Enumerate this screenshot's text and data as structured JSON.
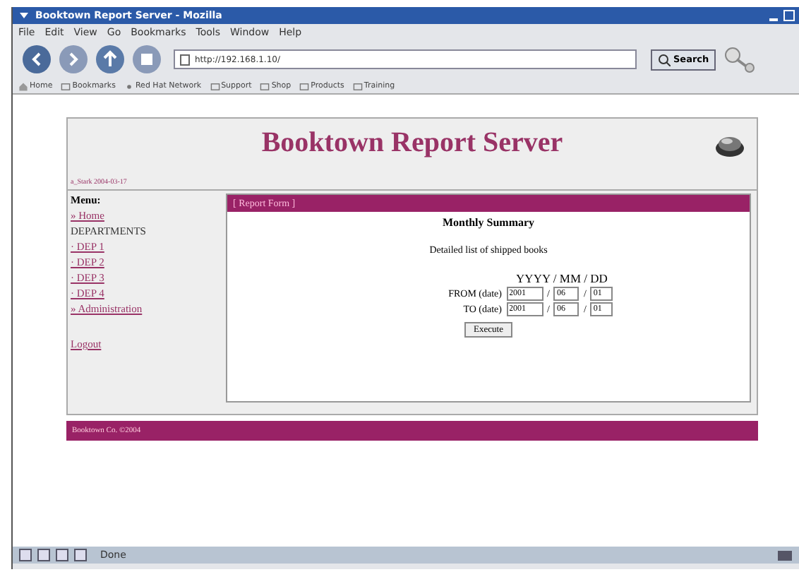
{
  "window": {
    "title": "Booktown Report Server - Mozilla"
  },
  "menu": [
    "File",
    "Edit",
    "View",
    "Go",
    "Bookmarks",
    "Tools",
    "Window",
    "Help"
  ],
  "address": {
    "value": "http://192.168.1.10/"
  },
  "search_button": "Search",
  "bookmarks": [
    {
      "label": "Home",
      "kind": "home"
    },
    {
      "label": "Bookmarks",
      "kind": "folder"
    },
    {
      "label": "Red Hat Network",
      "kind": "link"
    },
    {
      "label": "Support",
      "kind": "folder"
    },
    {
      "label": "Shop",
      "kind": "folder"
    },
    {
      "label": "Products",
      "kind": "folder"
    },
    {
      "label": "Training",
      "kind": "folder"
    }
  ],
  "page": {
    "title": "Booktown Report Server",
    "user_line": "a_Stark 2004-03-17",
    "sidebar": {
      "heading": "Menu:",
      "items": [
        {
          "label": "» Home",
          "kind": "link"
        },
        {
          "label": "DEPARTMENTS",
          "kind": "heading"
        },
        {
          "label": "· DEP 1",
          "kind": "link"
        },
        {
          "label": "· DEP 2",
          "kind": "link"
        },
        {
          "label": "· DEP 3",
          "kind": "link"
        },
        {
          "label": "· DEP 4",
          "kind": "link"
        },
        {
          "label": "» Administration",
          "kind": "link"
        },
        {
          "label": "Logout",
          "kind": "link"
        }
      ]
    },
    "form": {
      "header": "[ Report Form ]",
      "title": "Monthly Summary",
      "description": "Detailed list of shipped books",
      "format": "YYYY / MM / DD",
      "rows": [
        {
          "label": "FROM (date)",
          "year": "2001",
          "month": "06",
          "day": "01"
        },
        {
          "label": "TO (date)",
          "year": "2001",
          "month": "06",
          "day": "01"
        }
      ],
      "separator": "/",
      "button": "Execute"
    },
    "footer": "Booktown Co. ©2004"
  },
  "status_bar": {
    "text": "Done"
  }
}
